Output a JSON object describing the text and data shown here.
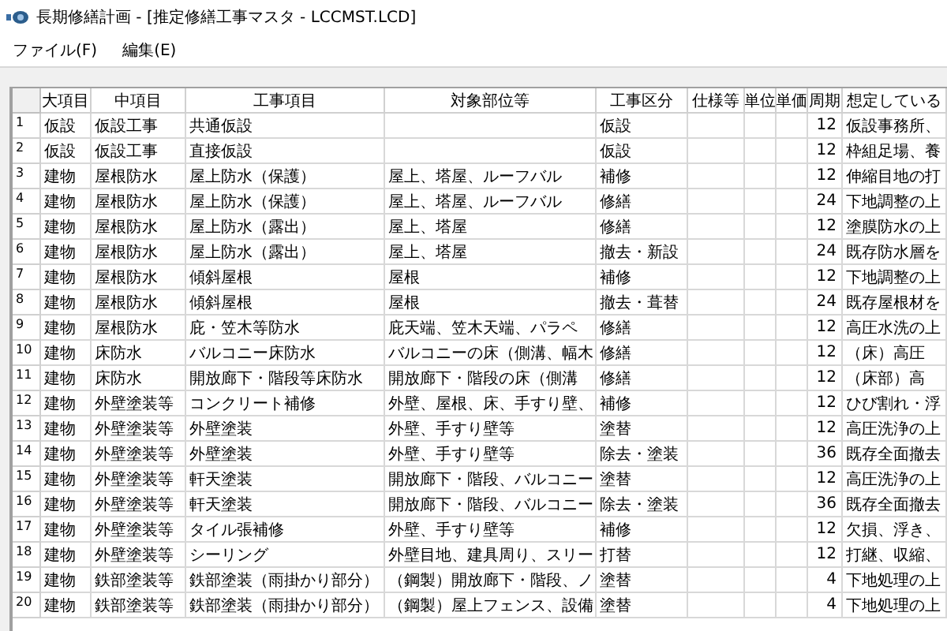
{
  "window": {
    "title": "長期修繕計画 - [推定修繕工事マスタ - LCCMST.LCD]"
  },
  "menu": [
    "ファイル(F)",
    "編集(E)"
  ],
  "table": {
    "columns": [
      "大項目",
      "中項目",
      "工事項目",
      "対象部位等",
      "工事区分",
      "仕様等",
      "単位",
      "単価",
      "周期",
      "想定している"
    ],
    "rows": [
      {
        "no": "1",
        "major": "仮設",
        "middle": "仮設工事",
        "item": "共通仮設",
        "category": "仮設",
        "cycle": "12",
        "assumed": "仮設事務所、"
      },
      {
        "no": "2",
        "major": "仮設",
        "middle": "仮設工事",
        "item": "直接仮設",
        "category": "仮設",
        "cycle": "12",
        "assumed": "枠組足場、養"
      },
      {
        "no": "3",
        "major": "建物",
        "middle": "屋根防水",
        "item": "屋上防水（保護）",
        "target": "屋上、塔屋、ルーフバル",
        "category": "補修",
        "cycle": "12",
        "assumed": "伸縮目地の打"
      },
      {
        "no": "4",
        "major": "建物",
        "middle": "屋根防水",
        "item": "屋上防水（保護）",
        "target": "屋上、塔屋、ルーフバル",
        "category": "修繕",
        "cycle": "24",
        "assumed": "下地調整の上"
      },
      {
        "no": "5",
        "major": "建物",
        "middle": "屋根防水",
        "item": "屋上防水（露出）",
        "target": "屋上、塔屋",
        "category": "修繕",
        "cycle": "12",
        "assumed": "塗膜防水の上"
      },
      {
        "no": "6",
        "major": "建物",
        "middle": "屋根防水",
        "item": "屋上防水（露出）",
        "target": "屋上、塔屋",
        "category": "撤去・新設",
        "cycle": "24",
        "assumed": "既存防水層を"
      },
      {
        "no": "7",
        "major": "建物",
        "middle": "屋根防水",
        "item": "傾斜屋根",
        "target": "屋根",
        "category": "補修",
        "cycle": "12",
        "assumed": "下地調整の上"
      },
      {
        "no": "8",
        "major": "建物",
        "middle": "屋根防水",
        "item": "傾斜屋根",
        "target": "屋根",
        "category": "撤去・葺替",
        "cycle": "24",
        "assumed": "既存屋根材を"
      },
      {
        "no": "9",
        "major": "建物",
        "middle": "屋根防水",
        "item": "庇・笠木等防水",
        "target": "庇天端、笠木天端、パラペ",
        "category": "修繕",
        "cycle": "12",
        "assumed": "高圧水洗の上"
      },
      {
        "no": "10",
        "major": "建物",
        "middle": "床防水",
        "item": "バルコニー床防水",
        "target": "バルコニーの床（側溝、幅木",
        "category": "修繕",
        "cycle": "12",
        "assumed": "（床）高圧"
      },
      {
        "no": "11",
        "major": "建物",
        "middle": "床防水",
        "item": "開放廊下・階段等床防水",
        "target": "開放廊下・階段の床（側溝",
        "category": "修繕",
        "cycle": "12",
        "assumed": "（床部）高"
      },
      {
        "no": "12",
        "major": "建物",
        "middle": "外壁塗装等",
        "item": "コンクリート補修",
        "target": "外壁、屋根、床、手すり壁、",
        "category": "補修",
        "cycle": "12",
        "assumed": "ひび割れ・浮"
      },
      {
        "no": "13",
        "major": "建物",
        "middle": "外壁塗装等",
        "item": "外壁塗装",
        "target": "外壁、手すり壁等",
        "category": "塗替",
        "cycle": "12",
        "assumed": "高圧洗浄の上"
      },
      {
        "no": "14",
        "major": "建物",
        "middle": "外壁塗装等",
        "item": "外壁塗装",
        "target": "外壁、手すり壁等",
        "category": "除去・塗装",
        "cycle": "36",
        "assumed": "既存全面撤去"
      },
      {
        "no": "15",
        "major": "建物",
        "middle": "外壁塗装等",
        "item": "軒天塗装",
        "target": "開放廊下・階段、バルコニー",
        "category": "塗替",
        "cycle": "12",
        "assumed": "高圧洗浄の上"
      },
      {
        "no": "16",
        "major": "建物",
        "middle": "外壁塗装等",
        "item": "軒天塗装",
        "target": "開放廊下・階段、バルコニー",
        "category": "除去・塗装",
        "cycle": "36",
        "assumed": "既存全面撤去"
      },
      {
        "no": "17",
        "major": "建物",
        "middle": "外壁塗装等",
        "item": "タイル張補修",
        "target": "外壁、手すり壁等",
        "category": "補修",
        "cycle": "12",
        "assumed": "欠損、浮き、"
      },
      {
        "no": "18",
        "major": "建物",
        "middle": "外壁塗装等",
        "item": "シーリング",
        "target": "外壁目地、建具周り、スリー",
        "category": "打替",
        "cycle": "12",
        "assumed": "打継、収縮、"
      },
      {
        "no": "19",
        "major": "建物",
        "middle": "鉄部塗装等",
        "item": "鉄部塗装（雨掛かり部分）",
        "target": "（鋼製）開放廊下・階段、ノ",
        "category": "塗替",
        "cycle": "4",
        "assumed": "下地処理の上"
      },
      {
        "no": "20",
        "major": "建物",
        "middle": "鉄部塗装等",
        "item": "鉄部塗装（雨掛かり部分）",
        "target": "（鋼製）屋上フェンス、設備",
        "category": "塗替",
        "cycle": "4",
        "assumed": "下地処理の上"
      }
    ]
  }
}
